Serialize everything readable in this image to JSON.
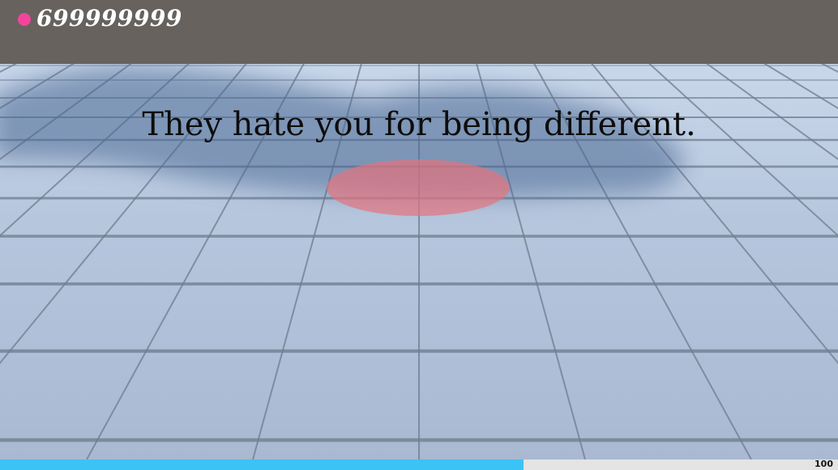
{
  "hud": {
    "score_icon": "pink-dot-icon",
    "score": "699999999",
    "score_dot_color": "#f2449b",
    "top_bar_color": "#67625e"
  },
  "scene": {
    "message": "They hate you for being different.",
    "target_color": "#e4737e"
  },
  "progress": {
    "percent": 62.5,
    "label": "100",
    "fill_color": "#3bc3f5"
  }
}
